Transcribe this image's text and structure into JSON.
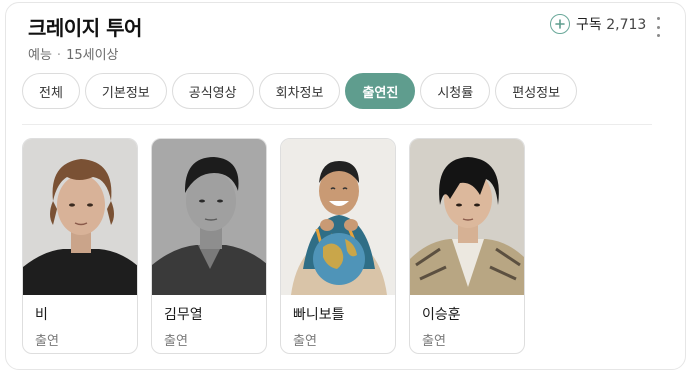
{
  "header": {
    "title": "크레이지 투어",
    "genre": "예능",
    "rating": "15세이상",
    "subscribe_label": "구독",
    "subscribe_count": "2,713"
  },
  "tabs": [
    {
      "label": "전체",
      "active": false
    },
    {
      "label": "기본정보",
      "active": false
    },
    {
      "label": "공식영상",
      "active": false
    },
    {
      "label": "회차정보",
      "active": false
    },
    {
      "label": "출연진",
      "active": true
    },
    {
      "label": "시청률",
      "active": false
    },
    {
      "label": "편성정보",
      "active": false
    }
  ],
  "cast": [
    {
      "name": "비",
      "role": "출연"
    },
    {
      "name": "김무열",
      "role": "출연"
    },
    {
      "name": "빠니보틀",
      "role": "출연"
    },
    {
      "name": "이승훈",
      "role": "출연"
    }
  ],
  "colors": {
    "accent": "#5f9d8e",
    "accent_border": "#6aa89a"
  },
  "icons": {
    "subscribe": "plus-circle-icon",
    "more": "more-vertical-icon"
  }
}
